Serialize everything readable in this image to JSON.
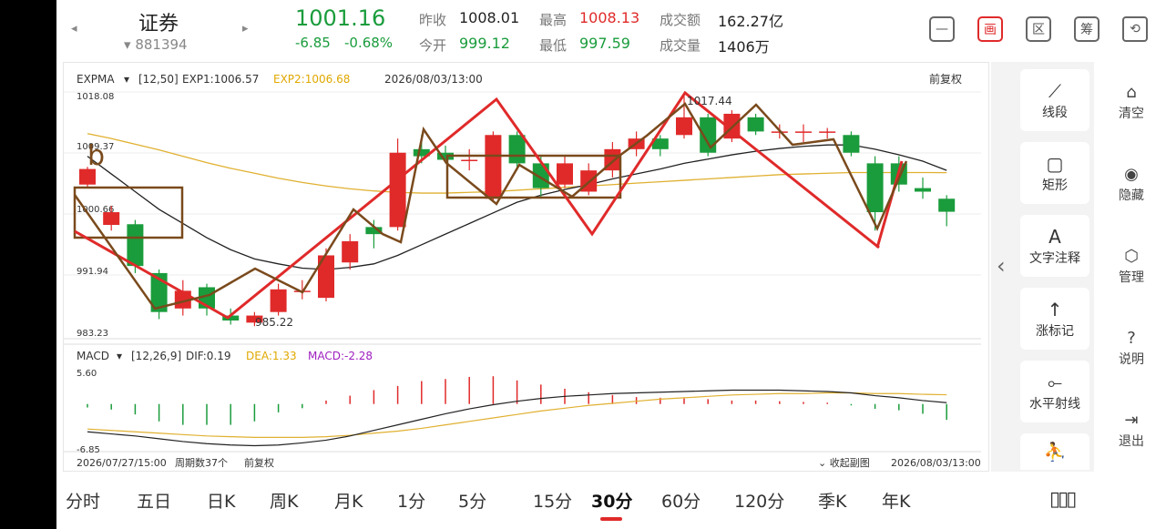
{
  "header": {
    "prev_arrow": "◂",
    "next_arrow": "▸",
    "stock_name": "证券",
    "stock_code": "881394",
    "price": "1001.16",
    "change": "-6.85",
    "change_pct": "-0.68%",
    "prev_close_label": "昨收",
    "prev_close": "1008.01",
    "open_label": "今开",
    "open": "999.12",
    "high_label": "最高",
    "high": "1008.13",
    "low_label": "最低",
    "low": "997.59",
    "turnover_label": "成交额",
    "turnover": "162.27亿",
    "volume_label": "成交量",
    "volume": "1406万",
    "top_icons": [
      {
        "name": "minimize-icon",
        "glyph": "—"
      },
      {
        "name": "draw-icon",
        "glyph": "画"
      },
      {
        "name": "range-icon",
        "glyph": "区"
      },
      {
        "name": "chips-icon",
        "glyph": "筹"
      },
      {
        "name": "rotate-screen-icon",
        "glyph": "⟲"
      }
    ]
  },
  "chart": {
    "indicator": "EXPMA",
    "params": "[12,50]",
    "exp1": "EXP1:1006.57",
    "exp2": "EXP2:1006.68",
    "timestamp": "2026/08/03/13:00",
    "adjust": "前复权",
    "y_ticks": [
      "1018.08",
      "1009.37",
      "1000.66",
      "991.94",
      "983.23"
    ],
    "high_label": "1017.44",
    "low_label": "985.22",
    "annotation_text": "b",
    "macd_indicator": "MACD",
    "macd_params": "[12,26,9]",
    "dif": "DIF:0.19",
    "dea": "DEA:1.33",
    "macd": "MACD:-2.28",
    "macd_top": "5.60",
    "macd_bottom": "-6.85",
    "footer_start": "2026/07/27/15:00",
    "footer_period": "周期数37个",
    "footer_adjust": "前复权",
    "footer_collapse": "收起副图",
    "footer_end": "2026/08/03/13:00"
  },
  "chart_data": {
    "type": "candlestick",
    "ylim": [
      983.23,
      1018.08
    ],
    "candles": [
      {
        "o": 1005.0,
        "c": 1007.2,
        "h": 1007.5,
        "l": 1004.5
      },
      {
        "o": 999.3,
        "c": 1001.1,
        "h": 1002.0,
        "l": 998.5
      },
      {
        "o": 999.4,
        "c": 993.5,
        "h": 1000.0,
        "l": 992.5
      },
      {
        "o": 992.5,
        "c": 987.0,
        "h": 993.0,
        "l": 986.0
      },
      {
        "o": 987.5,
        "c": 990.0,
        "h": 991.5,
        "l": 986.5
      },
      {
        "o": 990.5,
        "c": 987.5,
        "h": 991.0,
        "l": 986.5
      },
      {
        "o": 986.5,
        "c": 985.8,
        "h": 987.5,
        "l": 985.22
      },
      {
        "o": 985.5,
        "c": 986.5,
        "h": 987.0,
        "l": 985.0
      },
      {
        "o": 987.0,
        "c": 990.2,
        "h": 991.0,
        "l": 986.5
      },
      {
        "o": 990.0,
        "c": 990.0,
        "h": 991.5,
        "l": 988.8
      },
      {
        "o": 989.0,
        "c": 995.0,
        "h": 996.0,
        "l": 988.5
      },
      {
        "o": 994.0,
        "c": 997.0,
        "h": 998.0,
        "l": 993.0
      },
      {
        "o": 999.0,
        "c": 998.0,
        "h": 1000.0,
        "l": 996.0
      },
      {
        "o": 999.0,
        "c": 1009.5,
        "h": 1011.5,
        "l": 998.5
      },
      {
        "o": 1010.0,
        "c": 1009.0,
        "h": 1012.0,
        "l": 1008.0
      },
      {
        "o": 1009.5,
        "c": 1008.5,
        "h": 1010.5,
        "l": 1008.0
      },
      {
        "o": 1008.5,
        "c": 1008.5,
        "h": 1010.0,
        "l": 1007.0
      },
      {
        "o": 1003.0,
        "c": 1012.0,
        "h": 1012.5,
        "l": 1002.5
      },
      {
        "o": 1012.0,
        "c": 1008.0,
        "h": 1012.5,
        "l": 1007.0
      },
      {
        "o": 1008.0,
        "c": 1004.5,
        "h": 1009.0,
        "l": 1003.0
      },
      {
        "o": 1005.0,
        "c": 1008.0,
        "h": 1009.0,
        "l": 1004.5
      },
      {
        "o": 1004.0,
        "c": 1007.0,
        "h": 1008.0,
        "l": 1003.5
      },
      {
        "o": 1007.0,
        "c": 1010.0,
        "h": 1011.0,
        "l": 1006.0
      },
      {
        "o": 1010.0,
        "c": 1011.5,
        "h": 1012.5,
        "l": 1009.0
      },
      {
        "o": 1011.5,
        "c": 1010.0,
        "h": 1012.0,
        "l": 1009.0
      },
      {
        "o": 1012.0,
        "c": 1014.5,
        "h": 1017.44,
        "l": 1011.5
      },
      {
        "o": 1014.5,
        "c": 1009.5,
        "h": 1015.0,
        "l": 1009.0
      },
      {
        "o": 1011.5,
        "c": 1015.0,
        "h": 1015.5,
        "l": 1011.0
      },
      {
        "o": 1014.5,
        "c": 1012.5,
        "h": 1015.0,
        "l": 1012.0
      },
      {
        "o": 1012.5,
        "c": 1012.5,
        "h": 1013.5,
        "l": 1011.5
      },
      {
        "o": 1012.5,
        "c": 1012.5,
        "h": 1013.5,
        "l": 1011.0
      },
      {
        "o": 1012.5,
        "c": 1012.5,
        "h": 1013.0,
        "l": 1011.5
      },
      {
        "o": 1012.0,
        "c": 1009.5,
        "h": 1012.5,
        "l": 1009.0
      },
      {
        "o": 1008.0,
        "c": 1001.1,
        "h": 1009.0,
        "l": 998.5
      },
      {
        "o": 1008.0,
        "c": 1005.0,
        "h": 1009.0,
        "l": 1004.0
      },
      {
        "o": 1004.5,
        "c": 1004.0,
        "h": 1006.0,
        "l": 1003.0
      },
      {
        "o": 1003.0,
        "c": 1001.16,
        "h": 1003.5,
        "l": 999.12
      }
    ],
    "exp1": [
      1009.0,
      1006.5,
      1004.0,
      1001.5,
      999.5,
      997.5,
      995.8,
      994.5,
      993.8,
      993.2,
      993.0,
      993.3,
      993.8,
      995.0,
      996.5,
      998.0,
      999.5,
      1001.0,
      1002.5,
      1003.5,
      1004.3,
      1005.0,
      1005.8,
      1006.5,
      1007.2,
      1008.0,
      1008.6,
      1009.2,
      1009.7,
      1010.1,
      1010.4,
      1010.6,
      1010.6,
      1010.0,
      1009.2,
      1008.3,
      1007.0
    ],
    "exp2": [
      1012.2,
      1011.5,
      1010.7,
      1009.9,
      1009.0,
      1008.1,
      1007.3,
      1006.6,
      1005.9,
      1005.3,
      1004.8,
      1004.4,
      1004.1,
      1003.9,
      1003.8,
      1003.8,
      1003.9,
      1004.0,
      1004.2,
      1004.4,
      1004.6,
      1004.8,
      1005.0,
      1005.2,
      1005.4,
      1005.6,
      1005.8,
      1006.0,
      1006.2,
      1006.4,
      1006.5,
      1006.6,
      1006.7,
      1006.7,
      1006.7,
      1006.7,
      1006.68
    ],
    "macd_ylim": [
      -6.85,
      5.6
    ],
    "macd_hist": [
      -0.5,
      -0.8,
      -1.5,
      -2.5,
      -3.0,
      -3.0,
      -3.0,
      -2.5,
      -1.2,
      -0.6,
      0.5,
      1.2,
      2.0,
      2.6,
      3.3,
      3.6,
      3.9,
      4.0,
      3.4,
      2.8,
      2.2,
      1.7,
      1.3,
      1.0,
      0.9,
      0.8,
      0.7,
      0.5,
      0.5,
      0.4,
      0.3,
      0.2,
      -0.2,
      -0.7,
      -0.9,
      -1.4,
      -2.28
    ],
    "dif": [
      -4.0,
      -4.3,
      -4.6,
      -5.0,
      -5.4,
      -5.7,
      -5.9,
      -6.0,
      -5.9,
      -5.6,
      -5.2,
      -4.6,
      -3.8,
      -3.0,
      -2.2,
      -1.4,
      -0.7,
      -0.1,
      0.4,
      0.8,
      1.1,
      1.3,
      1.5,
      1.6,
      1.7,
      1.8,
      1.9,
      2.0,
      2.0,
      2.0,
      1.9,
      1.8,
      1.6,
      1.2,
      0.9,
      0.5,
      0.19
    ],
    "dea": [
      -3.6,
      -3.8,
      -4.0,
      -4.2,
      -4.4,
      -4.6,
      -4.7,
      -4.8,
      -4.8,
      -4.8,
      -4.7,
      -4.5,
      -4.2,
      -3.9,
      -3.5,
      -3.0,
      -2.5,
      -2.0,
      -1.5,
      -1.0,
      -0.6,
      -0.2,
      0.1,
      0.4,
      0.7,
      0.9,
      1.1,
      1.3,
      1.4,
      1.5,
      1.5,
      1.6,
      1.6,
      1.5,
      1.5,
      1.4,
      1.33
    ]
  },
  "tools": [
    {
      "label": "线段",
      "icon": "⟋",
      "name": "tool-line-segment"
    },
    {
      "label": "矩形",
      "icon": "▢",
      "name": "tool-rectangle"
    },
    {
      "label": "文字注释",
      "icon": "A",
      "name": "tool-text-note"
    },
    {
      "label": "涨标记",
      "icon": "↑",
      "name": "tool-up-mark"
    },
    {
      "label": "水平射线",
      "icon": "⟜",
      "name": "tool-horizontal-ray"
    },
    {
      "label": "",
      "icon": "⛹",
      "name": "tool-more"
    }
  ],
  "side": {
    "collapse_arrow": "‹",
    "items": [
      {
        "label": "清空",
        "icon": "⌂",
        "name": "clear-button"
      },
      {
        "label": "隐藏",
        "icon": "◉",
        "name": "hide-button"
      },
      {
        "label": "管理",
        "icon": "⬡",
        "name": "manage-button"
      },
      {
        "label": "说明",
        "icon": "?",
        "name": "help-button"
      },
      {
        "label": "退出",
        "icon": "⇥",
        "name": "exit-button"
      }
    ]
  },
  "tabs": [
    "分时",
    "五日",
    "日K",
    "周K",
    "月K",
    "1分",
    "5分",
    "15分",
    "30分",
    "60分",
    "120分",
    "季K",
    "年K"
  ],
  "active_tab": "30分"
}
